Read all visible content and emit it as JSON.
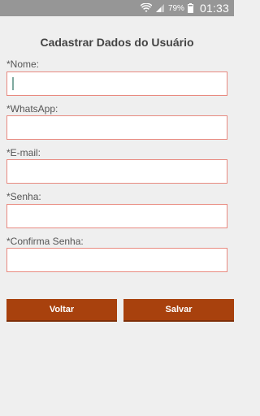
{
  "status_bar": {
    "battery_percent": "79%",
    "time": "01:33",
    "icons": [
      "wifi-icon",
      "signal-icon",
      "battery-icon"
    ]
  },
  "form": {
    "title": "Cadastrar Dados do Usuário",
    "fields": [
      {
        "label": "*Nome:",
        "value": "",
        "focused": true
      },
      {
        "label": "*WhatsApp:",
        "value": ""
      },
      {
        "label": "*E-mail:",
        "value": ""
      },
      {
        "label": "*Senha:",
        "value": ""
      },
      {
        "label": "*Confirma Senha:",
        "value": ""
      }
    ]
  },
  "buttons": {
    "back_label": "Voltar",
    "save_label": "Salvar"
  },
  "colors": {
    "status_bar": "#969696",
    "background": "#efefef",
    "input_border": "#e88a80",
    "button": "#a8410d"
  }
}
